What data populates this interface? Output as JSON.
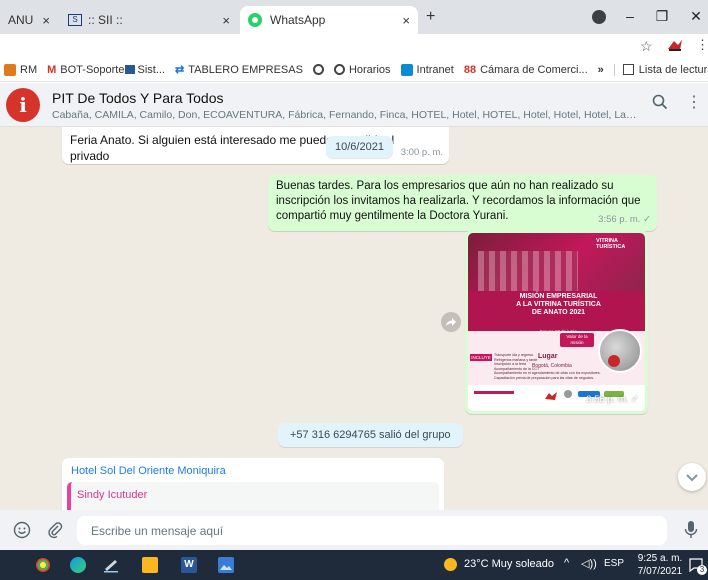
{
  "browser": {
    "tabs": [
      {
        "label": "ANU",
        "close": "×"
      },
      {
        "label": ":: SII ::",
        "close": "×"
      },
      {
        "label": "WhatsApp",
        "close": "×"
      }
    ],
    "new_tab": "+"
  },
  "bookmarks": [
    {
      "label": "RM",
      "color": "#e07a1f"
    },
    {
      "label": "BOT-Soporte",
      "color": "#d93025"
    },
    {
      "label": "Sist...",
      "color": "#2b5797"
    },
    {
      "label": "TABLERO EMPRESAS",
      "color": "#1a73e8"
    },
    {
      "label": "Horarios",
      "color": "#444444"
    },
    {
      "label": "Intranet",
      "color": "#0b8bd1"
    },
    {
      "label": "Cámara de Comerci...",
      "color": "#d93025"
    }
  ],
  "bookmarks_more": "»",
  "reading_list": "Lista de lectura",
  "chat": {
    "avatar_letter": "i",
    "title": "PIT De Todos Y Para Todos",
    "members": "Cabaña, CAMILA, Camilo, Don, ECOAVENTURA, Fábrica, Fernando, Finca, HOTEL, Hotel, HOTEL, Hotel, Hotel, Hotel, La, Lago, Milenio, ..."
  },
  "messages": {
    "msg1_text": "Feria Anato. Si alguien está interesado me pueden escribir al privado",
    "msg1_time": "3:00 p. m.",
    "date_chip": "10/6/2021",
    "msg2_text": "Buenas tardes.  Para los empresarios que aún no han realizado su inscripción los invitamos ha realizarla. Y recordamos la información que compartió muy gentilmente la Doctora Yurani.",
    "msg2_time": "3:56 p. m. ✓",
    "msg3_time": "3:56 p. m. ✓",
    "system_text": "+57 316 6294765 salió del grupo",
    "msg4_sender": "Hotel Sol Del Oriente Moniquira",
    "msg4_quote_author": "Sindy Icutuder"
  },
  "poster": {
    "brand": "VITRINA TURÍSTICA",
    "headline": "MISIÓN EMPRESARIAL\nA LA VITRINA TURÍSTICA\nDE ANATO 2021",
    "date": "Jueves 17 de junio",
    "valor": "Valor de la misión",
    "lugar_label": "Lugar",
    "lugar": "Bogotá, Colombia",
    "incluye": "INCLUYE",
    "items": [
      "Transporte ida y regreso.",
      "Refrigerios mañana y tarde",
      "Inscripción a la feria",
      "Acompañamiento de la CCT",
      "Acompañamiento en el agendamiento de citas con los expositores.",
      "Capacitación previa de preparación para las citas de negocios."
    ]
  },
  "composer": {
    "placeholder": "Escribe un mensaje aquí"
  },
  "taskbar": {
    "weather": "23°C  Muy soleado",
    "lang": "ESP",
    "time": "9:25 a. m.",
    "date": "7/07/2021",
    "notif": "3"
  },
  "colors": {
    "whatsapp_green": "#25d366",
    "outgoing_bubble": "#d9fdd3",
    "chat_bg": "#efeae2",
    "taskbar": "#1f2b3a",
    "poster_red": "#c2185b"
  }
}
